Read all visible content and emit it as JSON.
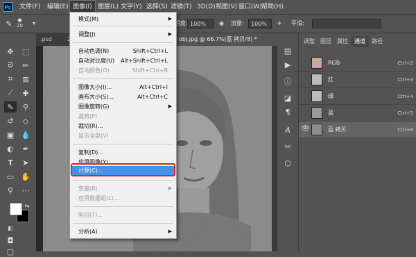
{
  "menubar": {
    "logo": "Ps",
    "items": [
      "文件(F)",
      "编辑(E)",
      "图像(I)",
      "图层(L)",
      "文字(Y)",
      "选择(S)",
      "滤镜(T)",
      "3D(D)",
      "视图(V)",
      "窗口(W)",
      "帮助(H)"
    ],
    "active_index": 2
  },
  "options_bar": {
    "brush_size": "20",
    "opacity_label": "不透明度:",
    "opacity_value": "100%",
    "flow_label": "流量:",
    "flow_value": "100%",
    "smoothing_label": "平滑:"
  },
  "document_tabs": [
    {
      "label": ".psd"
    },
    {
      "label": "22"
    },
    {
      "label": "obj.jpg @ 66.7%(蓝 拷贝/8) *"
    }
  ],
  "close_glyph": "×",
  "channels_panel": {
    "tabs": [
      "调整",
      "图层",
      "属性",
      "通道",
      "路径"
    ],
    "active_tab": 3,
    "rows": [
      {
        "name": "RGB",
        "shortcut": "Ctrl+2",
        "eye": ""
      },
      {
        "name": "红",
        "shortcut": "Ctrl+3",
        "eye": ""
      },
      {
        "name": "绿",
        "shortcut": "Ctrl+4",
        "eye": ""
      },
      {
        "name": "蓝",
        "shortcut": "Ctrl+5",
        "eye": ""
      },
      {
        "name": "蓝 拷贝",
        "shortcut": "Ctrl+6",
        "eye": "👁"
      }
    ]
  },
  "image_menu": {
    "items": [
      {
        "label": "模式(M)",
        "shortcut": "",
        "submenu": true,
        "disabled": false
      },
      {
        "label": "调整(J)",
        "shortcut": "",
        "submenu": true,
        "disabled": false
      },
      {
        "label": "自动色调(N)",
        "shortcut": "Shift+Ctrl+L",
        "submenu": false,
        "disabled": false
      },
      {
        "label": "自动对比度(U)",
        "shortcut": "Alt+Shift+Ctrl+L",
        "submenu": false,
        "disabled": false
      },
      {
        "label": "自动颜色(O)",
        "shortcut": "Shift+Ctrl+B",
        "submenu": false,
        "disabled": true
      },
      {
        "label": "图像大小(I)...",
        "shortcut": "Alt+Ctrl+I",
        "submenu": false,
        "disabled": false
      },
      {
        "label": "画布大小(S)...",
        "shortcut": "Alt+Ctrl+C",
        "submenu": false,
        "disabled": false
      },
      {
        "label": "图像旋转(G)",
        "shortcut": "",
        "submenu": true,
        "disabled": false
      },
      {
        "label": "裁剪(P)",
        "shortcut": "",
        "submenu": false,
        "disabled": true
      },
      {
        "label": "裁切(R)...",
        "shortcut": "",
        "submenu": false,
        "disabled": false
      },
      {
        "label": "显示全部(V)",
        "shortcut": "",
        "submenu": false,
        "disabled": true
      },
      {
        "label": "复制(D)...",
        "shortcut": "",
        "submenu": false,
        "disabled": false
      },
      {
        "label": "应用图像(Y)...",
        "shortcut": "",
        "submenu": false,
        "disabled": false
      },
      {
        "label": "计算(C)...",
        "shortcut": "",
        "submenu": false,
        "disabled": false,
        "highlighted": true
      },
      {
        "label": "变量(B)",
        "shortcut": "",
        "submenu": true,
        "disabled": true
      },
      {
        "label": "应用数据组(L)...",
        "shortcut": "",
        "submenu": false,
        "disabled": true
      },
      {
        "label": "陷印(T)...",
        "shortcut": "",
        "submenu": false,
        "disabled": true
      },
      {
        "label": "分析(A)",
        "shortcut": "",
        "submenu": true,
        "disabled": false
      }
    ]
  },
  "colors": {
    "accent": "#3f93f1",
    "highlight_box": "#e52322"
  }
}
